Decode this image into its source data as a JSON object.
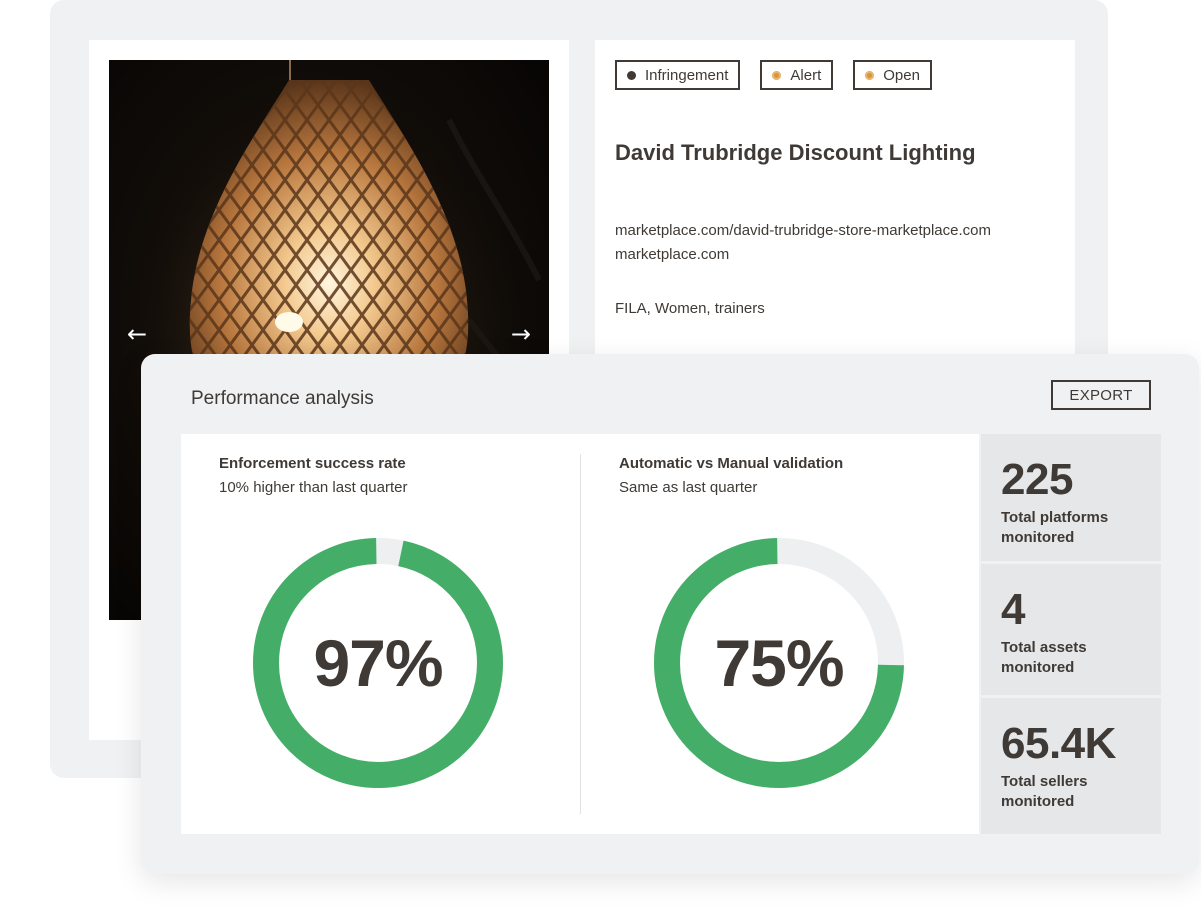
{
  "gallery": {
    "prev_arrow": "←",
    "next_arrow": "→"
  },
  "listing": {
    "tags": [
      {
        "label": "Infringement",
        "dot_color": "#3f3a36"
      },
      {
        "label": "Alert",
        "dot_color": "#d6953f"
      },
      {
        "label": "Open",
        "dot_color": "#d6953f"
      }
    ],
    "title": "David Trubridge Discount Lighting",
    "url": "marketplace.com/david-trubridge-store-marketplace.com",
    "domain": "marketplace.com",
    "keywords": "FILA, Women, trainers"
  },
  "performance": {
    "title": "Performance analysis",
    "export_label": "EXPORT",
    "charts": [
      {
        "title": "Enforcement success rate",
        "subtitle": "10% higher than last quarter",
        "percent": 97,
        "label": "97%"
      },
      {
        "title": "Automatic vs Manual validation",
        "subtitle": "Same as last quarter",
        "percent": 75,
        "label": "75%"
      }
    ],
    "stats": [
      {
        "value": "225",
        "label": "Total platforms monitored"
      },
      {
        "value": "4",
        "label": "Total assets monitored"
      },
      {
        "value": "65.4K",
        "label": "Total sellers monitored"
      }
    ]
  },
  "colors": {
    "accent_green": "#44ae68",
    "track_gray": "#eeeff0",
    "text_dark": "#3f3a36",
    "status_orange": "#d6953f"
  }
}
